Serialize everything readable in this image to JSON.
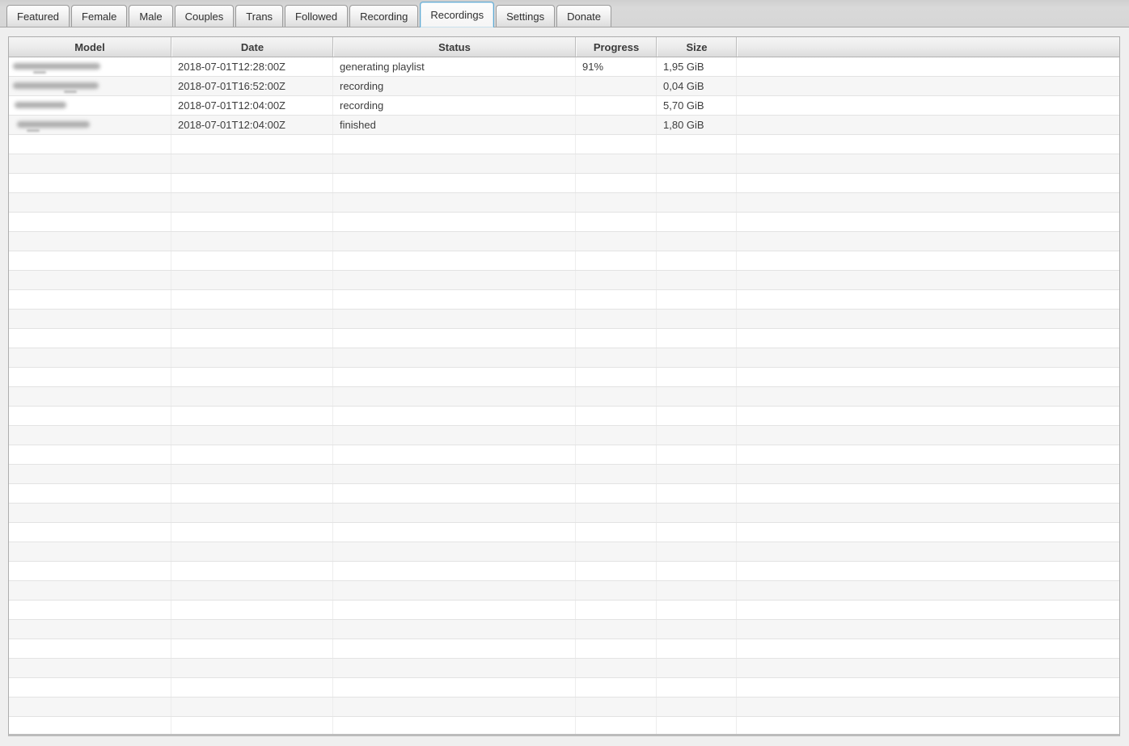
{
  "colors": {
    "accent_active_tab_border": "#5fa9d3",
    "page_background": "#efefef",
    "tabbar_background": "#d6d6d6",
    "row_stripe": "#f6f6f6",
    "header_text": "#3a3a3a",
    "cell_text": "#3d3d3d"
  },
  "tabs": {
    "items": [
      {
        "label": "Featured"
      },
      {
        "label": "Female"
      },
      {
        "label": "Male"
      },
      {
        "label": "Couples"
      },
      {
        "label": "Trans"
      },
      {
        "label": "Followed"
      },
      {
        "label": "Recording"
      },
      {
        "label": "Recordings"
      },
      {
        "label": "Settings"
      },
      {
        "label": "Donate"
      }
    ],
    "active": "Recordings"
  },
  "table": {
    "columns": [
      {
        "label": "Model"
      },
      {
        "label": "Date"
      },
      {
        "label": "Status"
      },
      {
        "label": "Progress"
      },
      {
        "label": "Size"
      },
      {
        "label": ""
      }
    ],
    "rows": [
      {
        "model_redacted": true,
        "date": "2018-07-01T12:28:00Z",
        "status": "generating playlist",
        "progress": "91%",
        "size": "1,95 GiB"
      },
      {
        "model_redacted": true,
        "date": "2018-07-01T16:52:00Z",
        "status": "recording",
        "progress": "",
        "size": "0,04 GiB"
      },
      {
        "model_redacted": true,
        "date": "2018-07-01T12:04:00Z",
        "status": "recording",
        "progress": "",
        "size": "5,70 GiB"
      },
      {
        "model_redacted": true,
        "date": "2018-07-01T12:04:00Z",
        "status": "finished",
        "progress": "",
        "size": "1,80 GiB"
      }
    ],
    "empty_row_count": 31
  }
}
